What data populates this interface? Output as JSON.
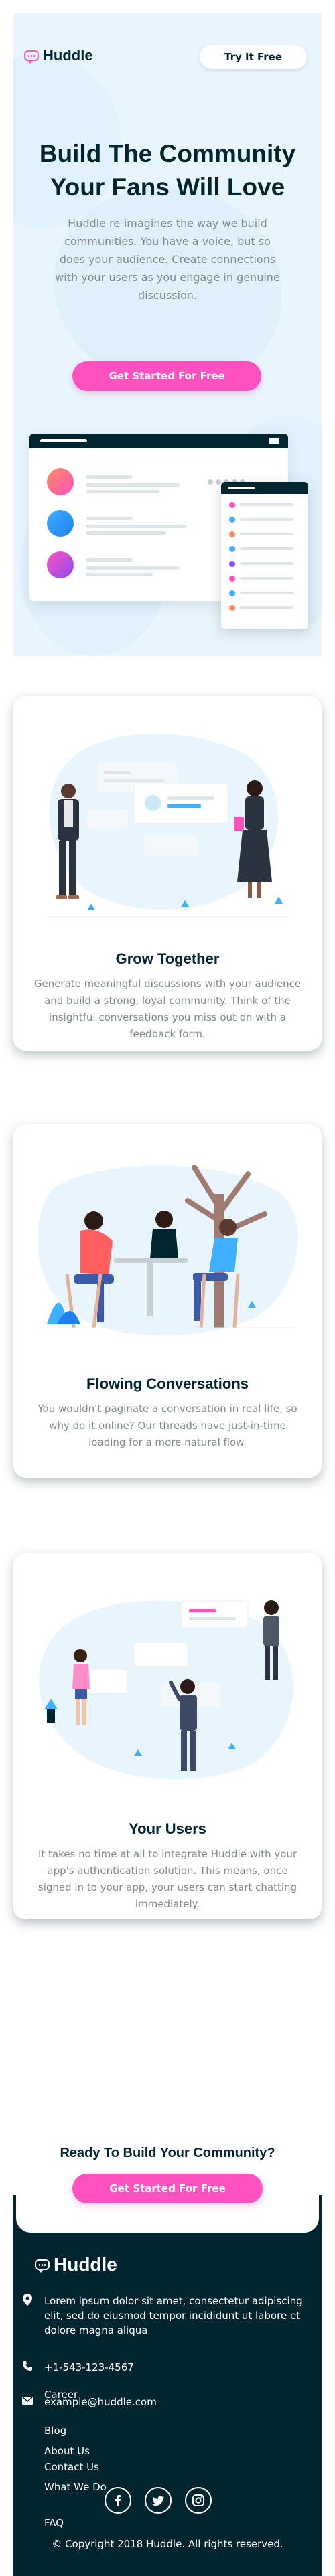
{
  "brand": {
    "name": "Huddle",
    "accent": "#ff52c1",
    "dark": "#00252e",
    "muted": "#818a8d",
    "hero_bg": "#e9f5fd"
  },
  "header": {
    "logo_icon": "chat-bubble-icon",
    "try_label": "Try It Free"
  },
  "hero": {
    "title": "Build The Community Your Fans Will Love",
    "description": "Huddle re-imagines the way we build communities. You have a voice, but so does your audience. Create connections with your users as you engage in genuine discussion.",
    "cta_label": "Get Started For Free"
  },
  "features": [
    {
      "title": "Grow Together",
      "description": "Generate meaningful discussions with your audience and build a strong, loyal community. Think of the insightful conversations you miss out on with a feedback form."
    },
    {
      "title": "Flowing Conversations",
      "description": "You wouldn't paginate a conversation in real life, so why do it online? Our threads have just-in-time loading for a more natural flow."
    },
    {
      "title": "Your Users",
      "description": "It takes no time at all to integrate Huddle with your app's authentication solution. This means, once signed in to your app, your users can start chatting immediately."
    }
  ],
  "cta": {
    "title": "Ready To Build Your Community?",
    "button_label": "Get Started For Free"
  },
  "footer": {
    "address": "Lorem ipsum dolor sit amet, consectetur adipiscing elit, sed do eiusmod tempor incididunt ut labore et dolore magna aliqua",
    "phone": "+1-543-123-4567",
    "email": "example@huddle.com",
    "links": [
      "About Us",
      "What We Do",
      "FAQ",
      "Career",
      "Blog",
      "Contact Us"
    ],
    "socials": [
      "facebook-icon",
      "twitter-icon",
      "instagram-icon"
    ],
    "copyright": "© Copyright 2018 Huddle. All rights reserved."
  }
}
